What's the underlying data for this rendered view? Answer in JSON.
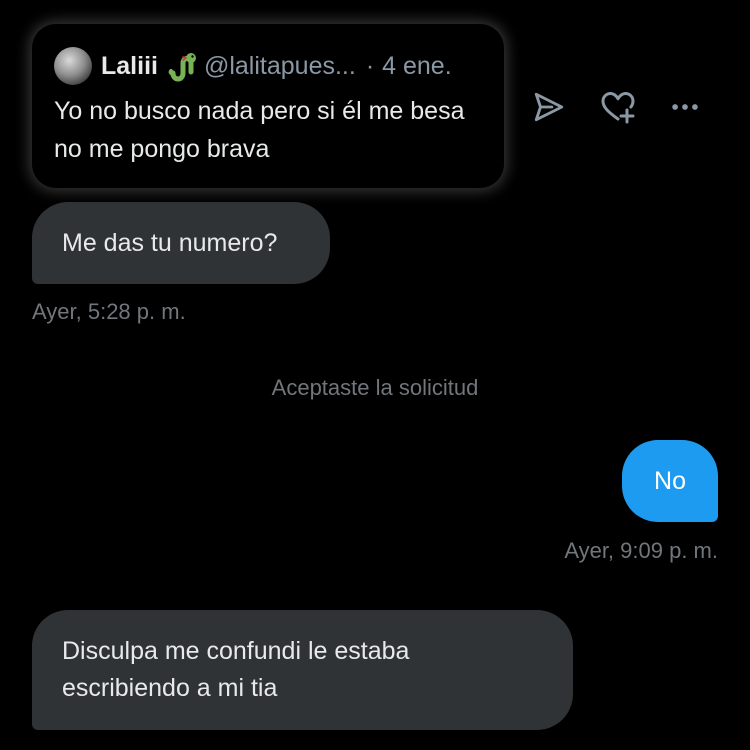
{
  "quoted_tweet": {
    "author_name": "Laliii",
    "emoji_icon": "snake-icon",
    "handle": "@lalitapues...",
    "separator": "·",
    "date": "4 ene.",
    "text": "Yo no busco nada pero si él me besa no me pongo brava"
  },
  "tweet_actions": [
    {
      "icon": "send-icon"
    },
    {
      "icon": "heart-plus-icon"
    },
    {
      "icon": "more-icon"
    }
  ],
  "messages": [
    {
      "text": "Me das tu numero?",
      "timestamp": "Ayer, 5:28 p. m."
    },
    {
      "text": "Aceptaste la solicitud"
    },
    {
      "text": "No",
      "timestamp": "Ayer, 9:09 p. m."
    },
    {
      "text": "Disculpa me confundi le estaba escribiendo a mi tia"
    }
  ],
  "colors": {
    "background": "#000000",
    "incoming_bubble": "#2f3336",
    "outgoing_bubble": "#1d9bf0",
    "muted_text": "#71767b",
    "primary_text": "#e7e9ea"
  }
}
